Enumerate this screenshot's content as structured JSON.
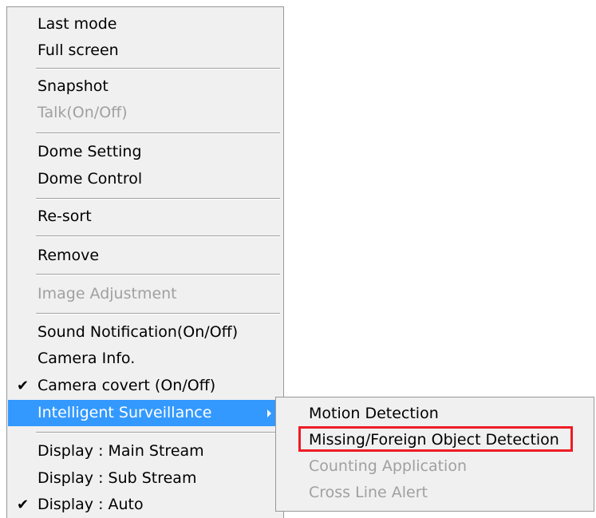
{
  "menu": {
    "items": [
      {
        "label": "Last mode",
        "disabled": false,
        "checked": false
      },
      {
        "label": "Full screen",
        "disabled": false,
        "checked": false
      },
      {
        "label": "Snapshot",
        "disabled": false,
        "checked": false
      },
      {
        "label": "Talk(On/Off)",
        "disabled": true,
        "checked": false
      },
      {
        "label": "Dome Setting",
        "disabled": false,
        "checked": false
      },
      {
        "label": "Dome Control",
        "disabled": false,
        "checked": false
      },
      {
        "label": "Re-sort",
        "disabled": false,
        "checked": false
      },
      {
        "label": "Remove",
        "disabled": false,
        "checked": false
      },
      {
        "label": "Image Adjustment",
        "disabled": true,
        "checked": false
      },
      {
        "label": "Sound Notification(On/Off)",
        "disabled": false,
        "checked": false
      },
      {
        "label": "Camera Info.",
        "disabled": false,
        "checked": false
      },
      {
        "label": "Camera covert (On/Off)",
        "disabled": false,
        "checked": true
      },
      {
        "label": "Intelligent Surveillance",
        "disabled": false,
        "checked": false,
        "highlighted": true,
        "has_submenu": true
      },
      {
        "label": "Display : Main Stream",
        "disabled": false,
        "checked": false
      },
      {
        "label": "Display : Sub Stream",
        "disabled": false,
        "checked": false
      },
      {
        "label": "Display : Auto",
        "disabled": false,
        "checked": true
      }
    ],
    "check_glyph": "✔"
  },
  "submenu": {
    "items": [
      {
        "label": "Motion Detection",
        "disabled": false
      },
      {
        "label": "Missing/Foreign Object Detection",
        "disabled": false,
        "highlight_box": true
      },
      {
        "label": "Counting Application",
        "disabled": true
      },
      {
        "label": "Cross Line Alert",
        "disabled": true
      }
    ]
  },
  "colors": {
    "highlight": "#3399ff",
    "highlight_box": "#ee1c24",
    "disabled_text": "#a0a0a0",
    "menu_bg": "#f0f0f0"
  }
}
